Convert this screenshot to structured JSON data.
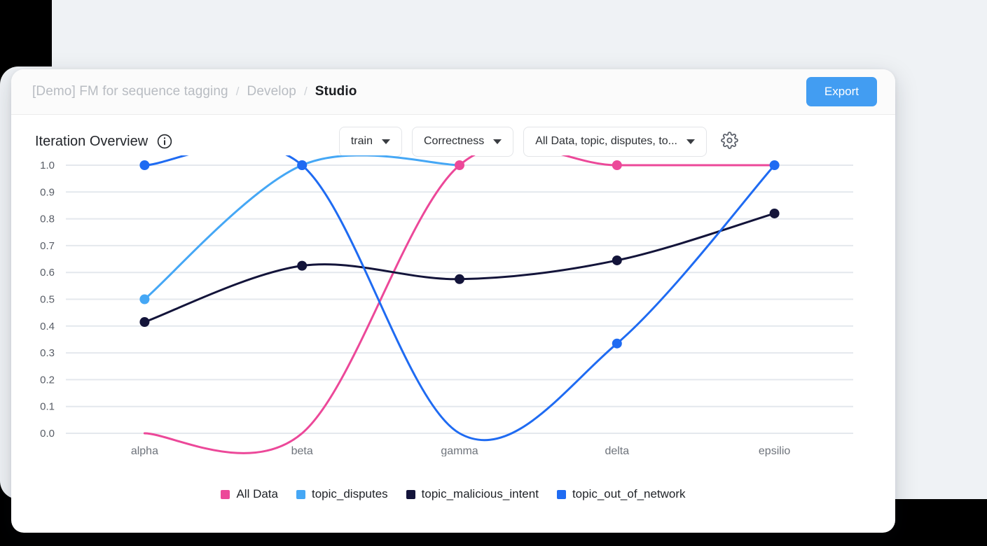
{
  "header": {
    "breadcrumb": [
      {
        "label": "[Demo] FM for sequence tagging",
        "active": false
      },
      {
        "label": "Develop",
        "active": false
      },
      {
        "label": "Studio",
        "active": true
      }
    ],
    "separator": "/",
    "export_label": "Export"
  },
  "toolbar": {
    "panel_title": "Iteration Overview",
    "info_icon": "info-circle-icon",
    "split_select": "train",
    "metric_select": "Correctness",
    "slice_select": "All Data, topic, disputes, to...",
    "gear_icon": "gear-icon"
  },
  "colors": {
    "all_data": "#ec4899",
    "topic_disputes": "#45a7f5",
    "topic_malicious_intent": "#13143a",
    "topic_out_of_network": "#1f6bf2",
    "export_blue": "#429df2",
    "grid": "#e4e8ed",
    "page_bg": "#eff2f5",
    "card_bg": "#ffffff"
  },
  "chart_data": {
    "type": "line",
    "title": "Iteration Overview",
    "xlabel": "",
    "ylabel": "",
    "categories": [
      "alpha",
      "beta",
      "gamma",
      "delta",
      "epsilio"
    ],
    "ylim": [
      0.0,
      1.0
    ],
    "yticks": [
      "0.0",
      "0.1",
      "0.2",
      "0.3",
      "0.4",
      "0.5",
      "0.6",
      "0.7",
      "0.8",
      "0.9",
      "1.0"
    ],
    "grid": true,
    "legend_position": "bottom",
    "curve": "smooth",
    "series": [
      {
        "name": "All Data",
        "color": "#ec4899",
        "values": [
          0.0,
          0.0,
          1.0,
          1.0,
          1.0
        ],
        "markers": [
          false,
          false,
          true,
          true,
          false
        ]
      },
      {
        "name": "topic_disputes",
        "color": "#45a7f5",
        "values": [
          0.5,
          1.0,
          1.0,
          null,
          null
        ],
        "markers": [
          true,
          true,
          false,
          false,
          false
        ]
      },
      {
        "name": "topic_malicious_intent",
        "color": "#13143a",
        "values": [
          0.415,
          0.625,
          0.575,
          0.645,
          0.82
        ],
        "markers": [
          true,
          true,
          true,
          true,
          true
        ]
      },
      {
        "name": "topic_out_of_network",
        "color": "#1f6bf2",
        "values": [
          1.0,
          1.0,
          0.0,
          0.335,
          1.0
        ],
        "markers": [
          true,
          true,
          false,
          true,
          true
        ]
      }
    ]
  },
  "legend": [
    {
      "label": "All Data",
      "color": "#ec4899"
    },
    {
      "label": "topic_disputes",
      "color": "#45a7f5"
    },
    {
      "label": "topic_malicious_intent",
      "color": "#13143a"
    },
    {
      "label": "topic_out_of_network",
      "color": "#1f6bf2"
    }
  ]
}
